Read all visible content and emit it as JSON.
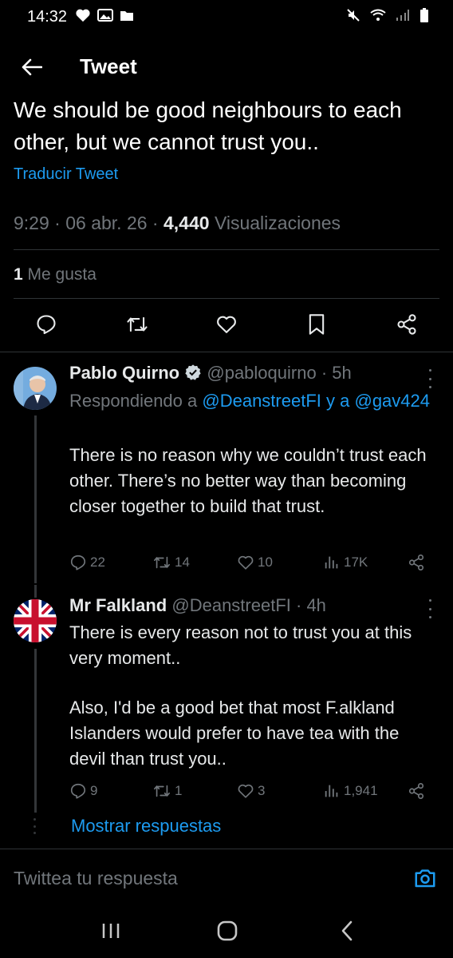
{
  "status_bar": {
    "time": "14:32"
  },
  "header": {
    "title": "Tweet"
  },
  "tweet": {
    "text": "We should be good neighbours to each other, but we cannot trust you..",
    "translate": "Traducir Tweet",
    "time": "9:29",
    "date": "06 abr. 26",
    "views": "4,440",
    "views_label": "Visualizaciones",
    "likes_count": "1",
    "likes_label": "Me gusta"
  },
  "replies": [
    {
      "name": "Pablo Quirno",
      "handle": "@pabloquirno",
      "time": "5h",
      "replying_prefix": "Respondiendo a",
      "replying_user1": "@DeanstreetFI",
      "replying_and": "y a",
      "replying_user2": "@gav424",
      "text": "There is no reason why we couldn’t trust each other. There’s no better way than becoming closer together to build that trust.",
      "replies": "22",
      "retweets": "14",
      "likes": "10",
      "views": "17K"
    },
    {
      "name": "Mr Falkland",
      "handle": "@DeanstreetFI",
      "time": "4h",
      "text_p1": "There is every reason not to trust you at this very moment..",
      "text_p2": "Also, I'd be a good bet that most F.alkland Islanders would prefer to have tea with the devil than trust you..",
      "replies": "9",
      "retweets": "1",
      "likes": "3",
      "views": "1,941"
    }
  ],
  "show_replies": "Mostrar respuestas",
  "reply_input": {
    "placeholder": "Twittea tu respuesta"
  },
  "colors": {
    "accent": "#1d9bf0",
    "muted": "#71767b",
    "background": "#000000"
  }
}
